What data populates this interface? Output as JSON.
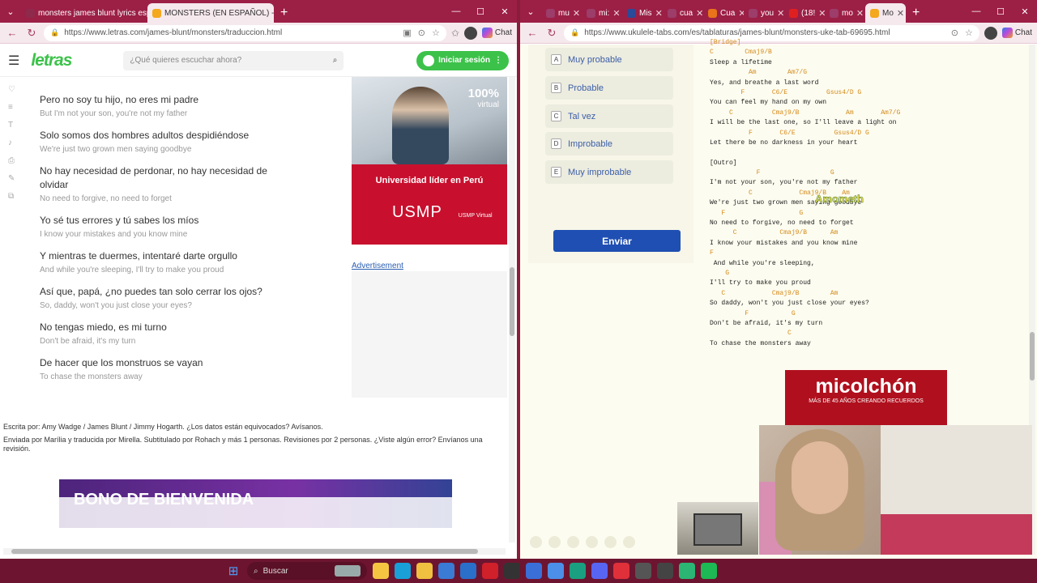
{
  "left_window": {
    "tabs": [
      {
        "label": "monsters james blunt lyrics españ",
        "active": false,
        "color": "#8f2a4d"
      },
      {
        "label": "MONSTERS (EN ESPAÑOL) - James",
        "active": true,
        "color": "#f4a81d"
      }
    ],
    "url": "https://www.letras.com/james-blunt/monsters/traduccion.html",
    "chat_label": "Chat"
  },
  "right_window": {
    "tabs": [
      {
        "label": "mu",
        "color": "#9c3d6a"
      },
      {
        "label": "mi:",
        "color": "#9c3d6a"
      },
      {
        "label": "Mis",
        "color": "#2a4a9a"
      },
      {
        "label": "cua",
        "color": "#9c3d6a"
      },
      {
        "label": "Cua",
        "color": "#e8731a"
      },
      {
        "label": "you",
        "color": "#9c3d6a"
      },
      {
        "label": "(18!",
        "color": "#e02020"
      },
      {
        "label": "mo",
        "color": "#9c3d6a"
      },
      {
        "label": "Mo",
        "color": "#f4a81d"
      }
    ],
    "url": "https://www.ukulele-tabs.com/es/tablaturas/james-blunt/monsters-uke-tab-69695.html",
    "chat_label": "Chat"
  },
  "letras": {
    "logo": "letras",
    "search_placeholder": "¿Qué quieres escuchar ahora?",
    "login_label": "Iniciar sesión",
    "lyrics": [
      {
        "es": "Pero no soy tu hijo, no eres mi padre",
        "en": "But I'm not your son, you're not my father"
      },
      {
        "es": "Solo somos dos hombres adultos despidiéndose",
        "en": "We're just two grown men saying goodbye"
      },
      {
        "es": "No hay necesidad de perdonar, no hay necesidad de olvidar",
        "en": "No need to forgive, no need to forget"
      },
      {
        "es": "Yo sé tus errores y tú sabes los míos",
        "en": "I know your mistakes and you know mine"
      },
      {
        "es": "Y mientras te duermes, intentaré darte orgullo",
        "en": "And while you're sleeping, I'll try to make you proud"
      },
      {
        "es": "Así que, papá, ¿no puedes tan solo cerrar los ojos?",
        "en": "So, daddy, won't you just close your eyes?"
      },
      {
        "es": "No tengas miedo, es mi turno",
        "en": "Don't be afraid, it's my turn"
      },
      {
        "es": "De hacer que los monstruos se vayan",
        "en": "To chase the monsters away"
      }
    ],
    "ad": {
      "pct": "100%",
      "virtual": "virtual",
      "headline": "Universidad líder en Perú",
      "brand": "USMP",
      "sub": "USMP Virtual"
    },
    "ad_link": "Advertisement",
    "credits_line1": "Escrita por: Amy Wadge / James Blunt / Jimmy Hogarth. ¿Los datos están equivocados? Avísanos.",
    "credits_line2": "Enviada por Marília y traducida por Mirella. Subtitulado por Rohach y más 1 personas. Revisiones por 2 personas. ¿Viste algún error? Envíanos una revisión.",
    "banner_text": "BONO DE BIENVENIDA"
  },
  "uke": {
    "poll_options": [
      {
        "key": "A",
        "label": "Muy probable"
      },
      {
        "key": "B",
        "label": "Probable"
      },
      {
        "key": "C",
        "label": "Tal vez"
      },
      {
        "key": "D",
        "label": "Improbable"
      },
      {
        "key": "E",
        "label": "Muy improbable"
      }
    ],
    "submit_label": "Enviar",
    "tab_lines": [
      {
        "t": "[Bridge]",
        "c": true
      },
      {
        "t": "C        Cmaj9/B",
        "c": true
      },
      {
        "t": "Sleep a lifetime",
        "c": false
      },
      {
        "t": "          Am        Am7/G",
        "c": true
      },
      {
        "t": "Yes, and breathe a last word",
        "c": false
      },
      {
        "t": "        F       C6/E          Gsus4/D G",
        "c": true
      },
      {
        "t": "You can feel my hand on my own",
        "c": false
      },
      {
        "t": "     C          Cmaj9/B            Am       Am7/G",
        "c": true
      },
      {
        "t": "I will be the last one, so I'll leave a light on",
        "c": false
      },
      {
        "t": "          F       C6/E          Gsus4/D G",
        "c": true
      },
      {
        "t": "Let there be no darkness in your heart",
        "c": false
      },
      {
        "t": "",
        "c": false
      },
      {
        "t": "[Outro]",
        "c": false
      },
      {
        "t": "            F                  G",
        "c": true
      },
      {
        "t": "I'm not your son, you're not my father",
        "c": false
      },
      {
        "t": "          C            Cmaj9/B    Am",
        "c": true
      },
      {
        "t": "We're just two grown men saying goodbye",
        "c": false
      },
      {
        "t": "   F                   G",
        "c": true
      },
      {
        "t": "No need to forgive, no need to forget",
        "c": false
      },
      {
        "t": "      C           Cmaj9/B      Am",
        "c": true
      },
      {
        "t": "I know your mistakes and you know mine",
        "c": false
      },
      {
        "t": "F",
        "c": true
      },
      {
        "t": " And while you're sleeping,",
        "c": false
      },
      {
        "t": "    G",
        "c": true
      },
      {
        "t": "I'll try to make you proud",
        "c": false
      },
      {
        "t": "   C            Cmaj9/B        Am",
        "c": true
      },
      {
        "t": "So daddy, won't you just close your eyes?",
        "c": false
      },
      {
        "t": "         F           G",
        "c": true
      },
      {
        "t": "Don't be afraid, it's my turn",
        "c": false
      },
      {
        "t": "                    C",
        "c": true
      },
      {
        "t": "To chase the monsters away",
        "c": false
      }
    ],
    "sticker": "Amometh",
    "micolchon": {
      "title": "micolchón",
      "tagline": "MÁS DE 45 AÑOS CREANDO RECUERDOS"
    }
  },
  "taskbar": {
    "search_label": "Buscar"
  }
}
